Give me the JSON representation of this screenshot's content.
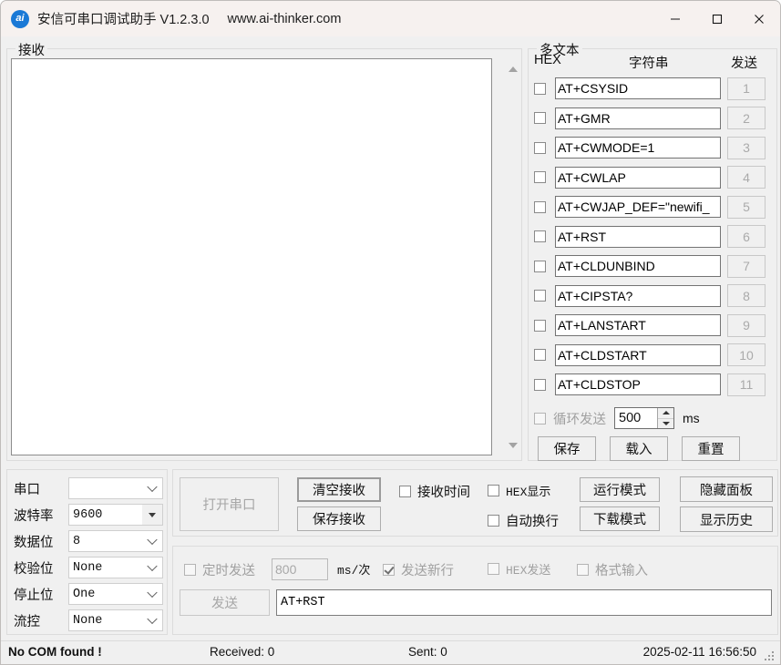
{
  "window": {
    "icon_label": "ai",
    "title": "安信可串口调试助手 V1.2.3.0",
    "url": "www.ai-thinker.com",
    "minimize_icon": "minimize-icon",
    "maximize_icon": "maximize-icon",
    "close_icon": "close-icon"
  },
  "receive_panel": {
    "label": "接收",
    "content": "",
    "scroll_up_icon": "scroll-up-arrow",
    "scroll_down_icon": "scroll-down-arrow"
  },
  "multitext_panel": {
    "label": "多文本",
    "headers": {
      "hex": "HEX",
      "string": "字符串",
      "send": "发送"
    },
    "rows": [
      {
        "hex_checked": false,
        "command": "AT+CSYSID",
        "send_label": "1"
      },
      {
        "hex_checked": false,
        "command": "AT+GMR",
        "send_label": "2"
      },
      {
        "hex_checked": false,
        "command": "AT+CWMODE=1",
        "send_label": "3"
      },
      {
        "hex_checked": false,
        "command": "AT+CWLAP",
        "send_label": "4"
      },
      {
        "hex_checked": false,
        "command": "AT+CWJAP_DEF=\"newifi_",
        "send_label": "5"
      },
      {
        "hex_checked": false,
        "command": "AT+RST",
        "send_label": "6"
      },
      {
        "hex_checked": false,
        "command": "AT+CLDUNBIND",
        "send_label": "7"
      },
      {
        "hex_checked": false,
        "command": "AT+CIPSTA?",
        "send_label": "8"
      },
      {
        "hex_checked": false,
        "command": "AT+LANSTART",
        "send_label": "9"
      },
      {
        "hex_checked": false,
        "command": "AT+CLDSTART",
        "send_label": "10"
      },
      {
        "hex_checked": false,
        "command": "AT+CLDSTOP",
        "send_label": "11"
      }
    ],
    "loop_send": {
      "label": "循环发送",
      "checked": false,
      "interval": "500",
      "unit": "ms"
    },
    "actions": {
      "save": "保存",
      "load": "载入",
      "reset": "重置"
    }
  },
  "serial_settings": {
    "rows": [
      {
        "label": "串口",
        "value": "",
        "arrow": "chevron-down-icon"
      },
      {
        "label": "波特率",
        "value": "9600",
        "arrow": "triangle-down-icon"
      },
      {
        "label": "数据位",
        "value": "8",
        "arrow": "chevron-down-icon"
      },
      {
        "label": "校验位",
        "value": "None",
        "arrow": "chevron-down-icon"
      },
      {
        "label": "停止位",
        "value": "One",
        "arrow": "chevron-down-icon"
      },
      {
        "label": "流控",
        "value": "None",
        "arrow": "chevron-down-icon"
      }
    ]
  },
  "operations": {
    "open_port": "打开串口",
    "clear_receive": "清空接收",
    "save_receive": "保存接收",
    "recv_time": {
      "label": "接收时间",
      "checked": false
    },
    "hex_display": {
      "label": "HEX显示",
      "checked": false
    },
    "auto_wrap": {
      "label": "自动换行",
      "checked": false
    },
    "run_mode": "运行模式",
    "download_mode": "下载模式",
    "hide_panel": "隐藏面板",
    "show_history": "显示历史"
  },
  "send_panel": {
    "timed_send": {
      "label": "定时发送",
      "checked": false
    },
    "timer_value": "800",
    "timer_unit": "ms/次",
    "send_newline": {
      "label": "发送新行",
      "checked": true
    },
    "hex_send": {
      "label": "HEX发送",
      "checked": false
    },
    "format_input": {
      "label": "格式输入",
      "checked": false
    },
    "send_button": "发送",
    "send_text": "AT+RST"
  },
  "statusbar": {
    "com_status": "No COM found !",
    "received": "Received: 0",
    "sent": "Sent: 0",
    "datetime": "2025-02-11 16:56:50"
  },
  "colors": {
    "titlebar": "#f6f1ef",
    "window_bg": "#f0f0f0",
    "accent": "#1a79d6",
    "field_bg": "#ffffff",
    "disabled_text": "#a6a6a6"
  }
}
